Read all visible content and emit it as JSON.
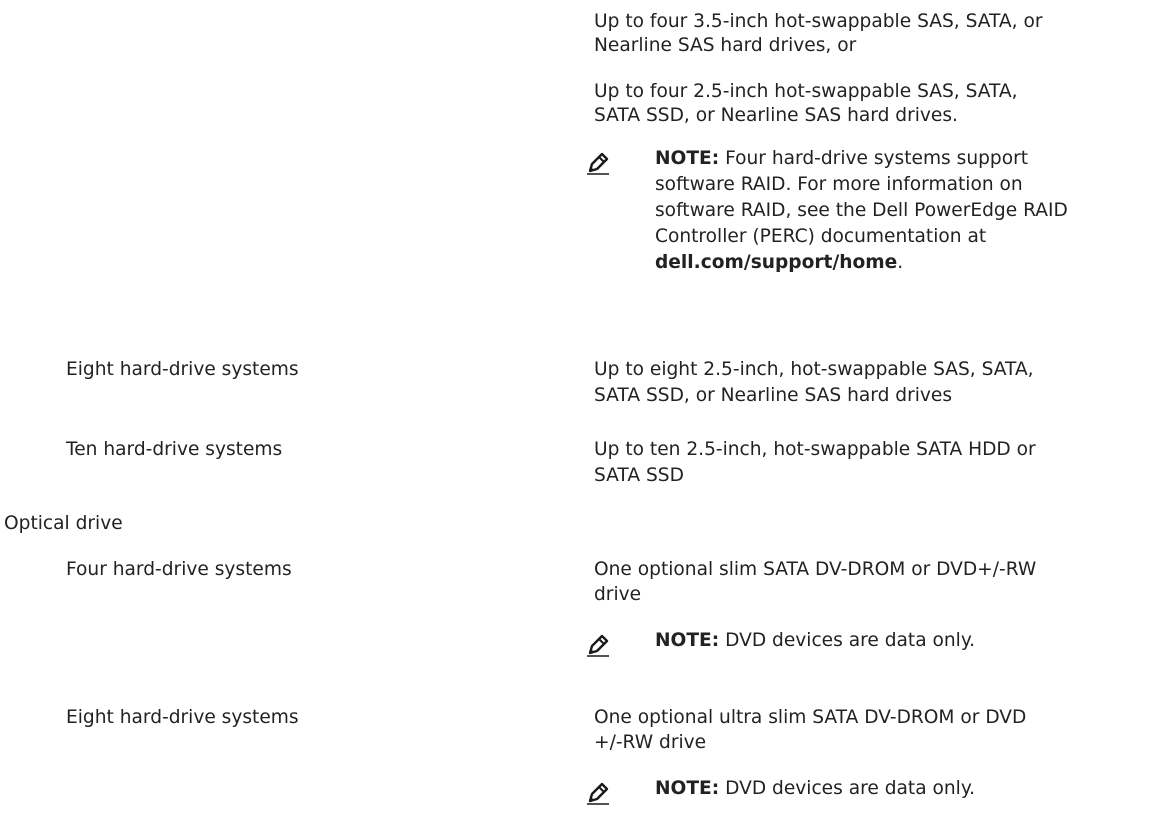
{
  "hard_drives_four": {
    "line1": "Up to four 3.5-inch hot-swappable SAS, SATA, or",
    "line2": "Nearline SAS hard drives, or",
    "line3": "Up to four 2.5-inch hot-swappable SAS, SATA,",
    "line4": "SATA SSD, or Nearline SAS hard drives.",
    "note": {
      "label": "NOTE:",
      "text1": " Four hard-drive systems support",
      "text2": "software RAID. For more information on",
      "text3": "software RAID, see the Dell PowerEdge RAID",
      "text4": "Controller (PERC) documentation at",
      "link": "dell.com/support/home",
      "period": "."
    }
  },
  "rows": [
    {
      "label": "Eight hard-drive systems",
      "value1": "Up to eight 2.5-inch, hot-swappable SAS, SATA,",
      "value2": "SATA SSD, or Nearline SAS hard drives"
    },
    {
      "label": "Ten hard-drive systems",
      "value1": "Up to ten 2.5-inch, hot-swappable SATA HDD or",
      "value2": "SATA SSD"
    }
  ],
  "optical": {
    "heading": "Optical drive",
    "rows": [
      {
        "label": "Four hard-drive systems",
        "value1": "One optional slim SATA DV-DROM or DVD+/-RW",
        "value2": "drive",
        "note_label": "NOTE:",
        "note_text": " DVD devices are data only."
      },
      {
        "label": "Eight hard-drive systems",
        "value1": "One optional ultra slim SATA DV-DROM or DVD",
        "value2": "+/-RW drive",
        "note_label": "NOTE:",
        "note_text": " DVD devices are data only."
      }
    ]
  },
  "icons": {
    "note": "pencil-note-icon"
  },
  "colors": {
    "text": "#222222",
    "icon": "#1a1a1a"
  }
}
